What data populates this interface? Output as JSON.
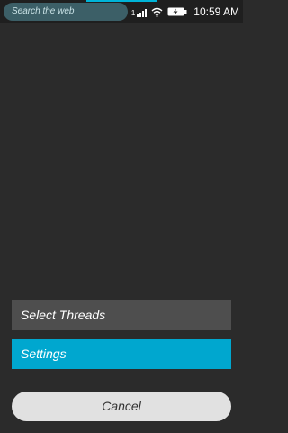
{
  "status_bar": {
    "search_placeholder": "Search the web",
    "signal_label": "1",
    "time": "10:59 AM",
    "accent_color": "#00b4d8"
  },
  "menu": {
    "items": [
      {
        "label": "Select Threads",
        "icon": "none"
      },
      {
        "label": "Settings",
        "icon": "none",
        "highlight_color": "#00a7cf"
      }
    ]
  },
  "footer": {
    "cancel_label": "Cancel"
  },
  "icons": [
    "signal-icon",
    "wifi-icon",
    "battery-charging-icon"
  ]
}
